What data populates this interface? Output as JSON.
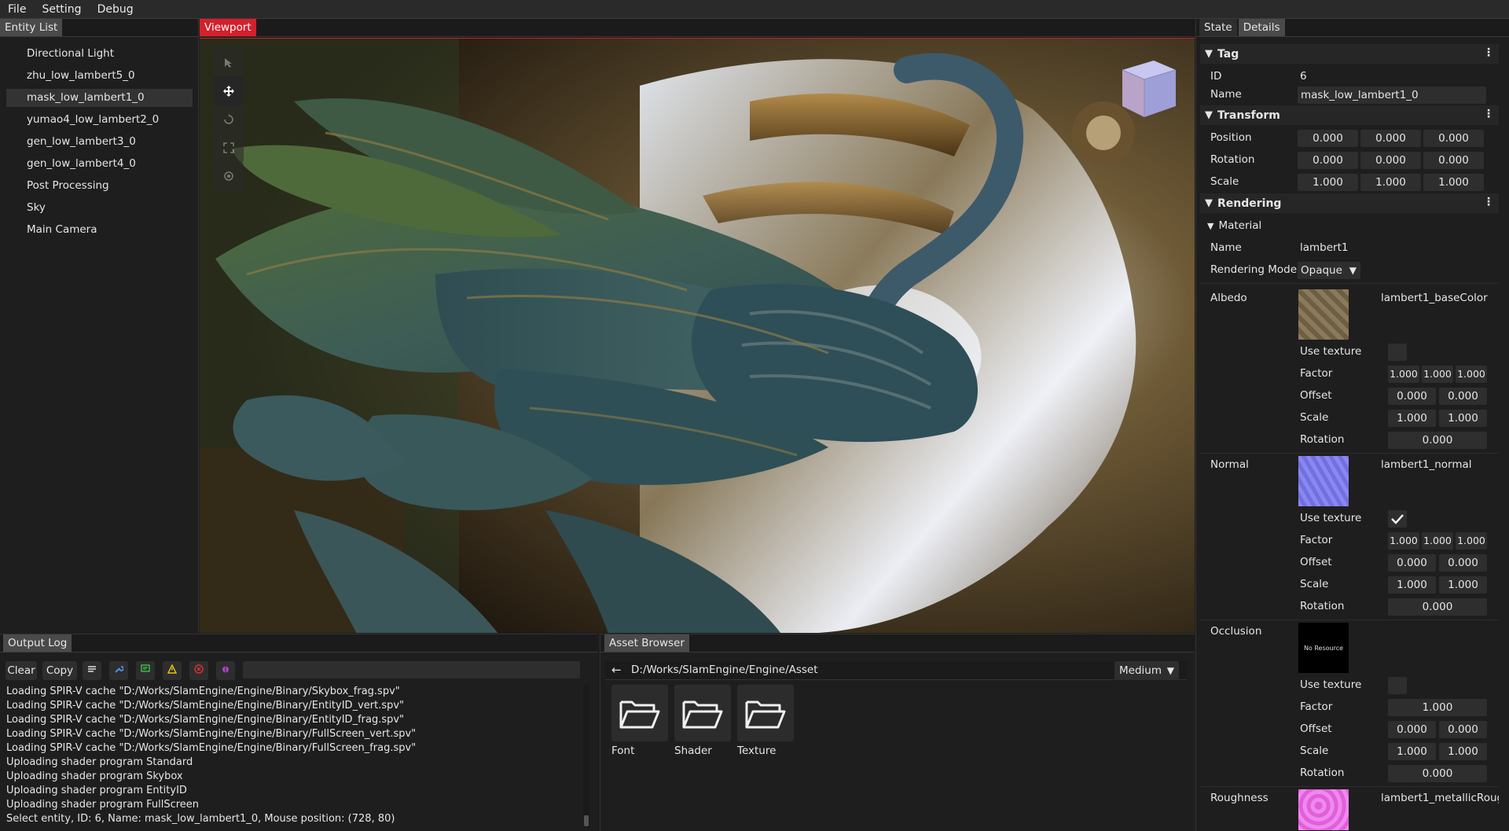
{
  "menu": [
    "File",
    "Setting",
    "Debug"
  ],
  "entity_panel": {
    "tab": "Entity List",
    "items": [
      "Directional Light",
      "zhu_low_lambert5_0",
      "mask_low_lambert1_0",
      "yumao4_low_lambert2_0",
      "gen_low_lambert3_0",
      "gen_low_lambert4_0",
      "Post Processing",
      "Sky",
      "Main Camera"
    ],
    "selected_index": 2
  },
  "viewport": {
    "tab": "Viewport",
    "tools": [
      "select-icon",
      "move-icon",
      "rotate-icon",
      "scale-icon",
      "universal-icon"
    ]
  },
  "details": {
    "tabs": [
      "State",
      "Details"
    ],
    "tag": {
      "title": "Tag",
      "id_label": "ID",
      "id_value": "6",
      "name_label": "Name",
      "name_value": "mask_low_lambert1_0"
    },
    "transform": {
      "title": "Transform",
      "position_label": "Position",
      "position": [
        "0.000",
        "0.000",
        "0.000"
      ],
      "rotation_label": "Rotation",
      "rotation": [
        "0.000",
        "0.000",
        "0.000"
      ],
      "scale_label": "Scale",
      "scale": [
        "1.000",
        "1.000",
        "1.000"
      ]
    },
    "rendering": {
      "title": "Rendering",
      "material_title": "Material",
      "name_label": "Name",
      "name_value": "lambert1",
      "mode_label": "Rendering Mode",
      "mode_value": "Opaque",
      "albedo": {
        "label": "Albedo",
        "texture": "lambert1_baseColor",
        "use_texture_label": "Use texture",
        "use_texture": false,
        "factor_label": "Factor",
        "factor": [
          "1.000",
          "1.000",
          "1.000"
        ],
        "offset_label": "Offset",
        "offset": [
          "0.000",
          "0.000"
        ],
        "scale_label": "Scale",
        "scale": [
          "1.000",
          "1.000"
        ],
        "rotation_label": "Rotation",
        "rotation": "0.000"
      },
      "normal": {
        "label": "Normal",
        "texture": "lambert1_normal",
        "use_texture_label": "Use texture",
        "use_texture": true,
        "factor_label": "Factor",
        "factor": [
          "1.000",
          "1.000",
          "1.000"
        ],
        "offset_label": "Offset",
        "offset": [
          "0.000",
          "0.000"
        ],
        "scale_label": "Scale",
        "scale": [
          "1.000",
          "1.000"
        ],
        "rotation_label": "Rotation",
        "rotation": "0.000"
      },
      "occlusion": {
        "label": "Occlusion",
        "no_resource": "No Resource",
        "use_texture_label": "Use texture",
        "use_texture": false,
        "factor_label": "Factor",
        "factor": "1.000",
        "offset_label": "Offset",
        "offset": [
          "0.000",
          "0.000"
        ],
        "scale_label": "Scale",
        "scale": [
          "1.000",
          "1.000"
        ],
        "rotation_label": "Rotation",
        "rotation": "0.000"
      },
      "roughness": {
        "label": "Roughness",
        "texture": "lambert1_metallicRougl"
      }
    }
  },
  "output_log": {
    "tab": "Output Log",
    "clear_label": "Clear",
    "copy_label": "Copy",
    "filter_placeholder": "",
    "lines": [
      "Loading SPIR-V cache \"D:/Works/SlamEngine/Engine/Binary/Skybox_frag.spv\"",
      "Loading SPIR-V cache \"D:/Works/SlamEngine/Engine/Binary/EntityID_vert.spv\"",
      "Loading SPIR-V cache \"D:/Works/SlamEngine/Engine/Binary/EntityID_frag.spv\"",
      "Loading SPIR-V cache \"D:/Works/SlamEngine/Engine/Binary/FullScreen_vert.spv\"",
      "Loading SPIR-V cache \"D:/Works/SlamEngine/Engine/Binary/FullScreen_frag.spv\"",
      "Uploading shader program Standard",
      "Uploading shader program Skybox",
      "Uploading shader program EntityID",
      "Uploading shader program FullScreen",
      "Select entity, ID: 6, Name: mask_low_lambert1_0, Mouse position: (728, 80)"
    ]
  },
  "asset_browser": {
    "tab": "Asset Browser",
    "path": "D:/Works/SlamEngine/Engine/Asset",
    "size_option": "Medium",
    "folders": [
      "Font",
      "Shader",
      "Texture"
    ]
  },
  "colors": {
    "accent_red": "#d4202c",
    "panel": "#1e1e1e",
    "field": "#2e2e2e"
  }
}
